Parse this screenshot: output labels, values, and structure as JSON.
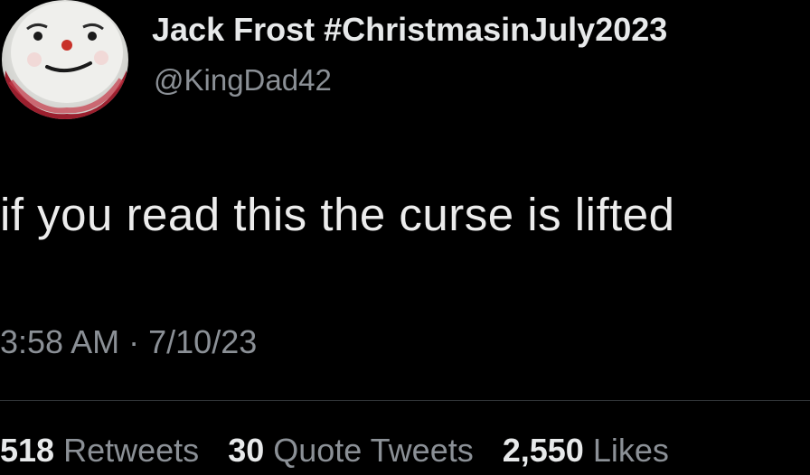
{
  "user": {
    "display_name": "Jack Frost #ChristmasinJuly2023",
    "handle": "@KingDad42",
    "avatar_icon": "snowman-face-avatar"
  },
  "tweet": {
    "text": "if you read this the curse is lifted",
    "time": "3:58 AM",
    "separator": "·",
    "date": "7/10/23"
  },
  "stats": {
    "retweets_count": "518",
    "retweets_label": "Retweets",
    "quotes_count": "30",
    "quotes_label": "Quote Tweets",
    "likes_count": "2,550",
    "likes_label": "Likes"
  },
  "colors": {
    "background": "#000000",
    "primary_text": "#e7e9ea",
    "secondary_text": "#8b9096",
    "divider": "#2f3336"
  }
}
